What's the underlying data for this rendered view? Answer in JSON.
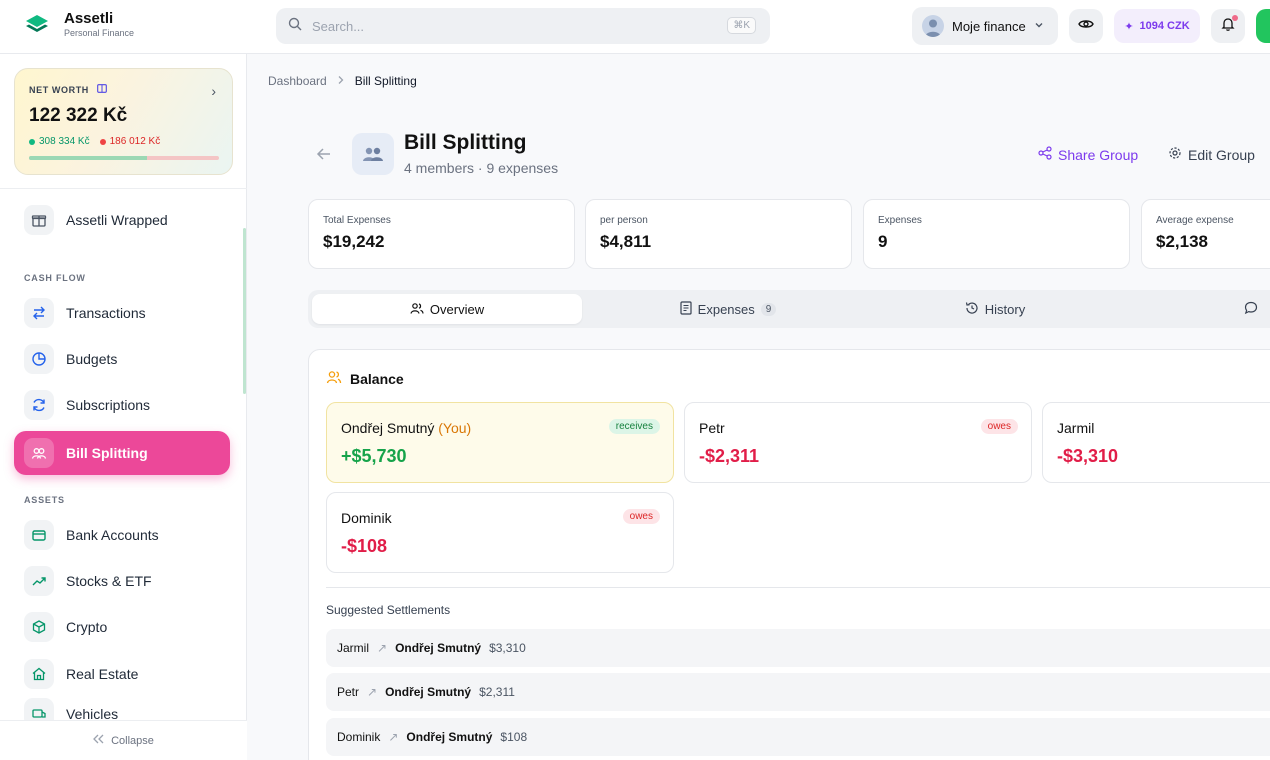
{
  "brand": {
    "name": "Assetli",
    "tagline": "Personal Finance"
  },
  "search": {
    "placeholder": "Search...",
    "shortcut": "⌘K"
  },
  "profile": {
    "name": "Moje finance"
  },
  "credits": {
    "label": "1094 CZK"
  },
  "net_worth": {
    "label": "NET WORTH",
    "value": "122 322 Kč",
    "assets": "308 334 Kč",
    "liabilities": "186 012 Kč",
    "asset_share": 0.62
  },
  "sidebar": {
    "wrapped": "Assetli Wrapped",
    "cash_flow_label": "CASH FLOW",
    "cash_flow": [
      "Transactions",
      "Budgets",
      "Subscriptions",
      "Bill Splitting"
    ],
    "assets_label": "ASSETS",
    "assets": [
      "Bank Accounts",
      "Stocks & ETF",
      "Crypto",
      "Real Estate",
      "Vehicles"
    ],
    "collapse": "Collapse"
  },
  "breadcrumb": {
    "root": "Dashboard",
    "current": "Bill Splitting"
  },
  "group": {
    "title": "Bill Splitting",
    "subtitle": "4 members · 9 expenses",
    "share": "Share Group",
    "edit": "Edit Group"
  },
  "stats": [
    {
      "label": "Total Expenses",
      "value": "$19,242"
    },
    {
      "label": "per person",
      "value": "$4,811"
    },
    {
      "label": "Expenses",
      "value": "9"
    },
    {
      "label": "Average expense",
      "value": "$2,138"
    }
  ],
  "tabs": [
    {
      "label": "Overview"
    },
    {
      "label": "Expenses",
      "badge": "9"
    },
    {
      "label": "History"
    }
  ],
  "balance": {
    "title": "Balance",
    "you_tag": "(You)",
    "members": [
      {
        "name": "Ondřej Smutný",
        "amount": "+$5,730",
        "status": "receives"
      },
      {
        "name": "Petr",
        "amount": "-$2,311",
        "status": "owes"
      },
      {
        "name": "Jarmil",
        "amount": "-$3,310",
        "status": "owes"
      },
      {
        "name": "Dominik",
        "amount": "-$108",
        "status": "owes"
      }
    ]
  },
  "settlements": {
    "title": "Suggested Settlements",
    "rows": [
      {
        "from": "Jarmil",
        "to": "Ondřej Smutný",
        "amount": "$3,310"
      },
      {
        "from": "Petr",
        "to": "Ondřej Smutný",
        "amount": "$2,311"
      },
      {
        "from": "Dominik",
        "to": "Ondřej Smutný",
        "amount": "$108"
      }
    ]
  },
  "colors": {
    "accent": "#ec4899",
    "positive": "#16a34a",
    "negative": "#e11d48",
    "brand_green": "#10b981"
  }
}
